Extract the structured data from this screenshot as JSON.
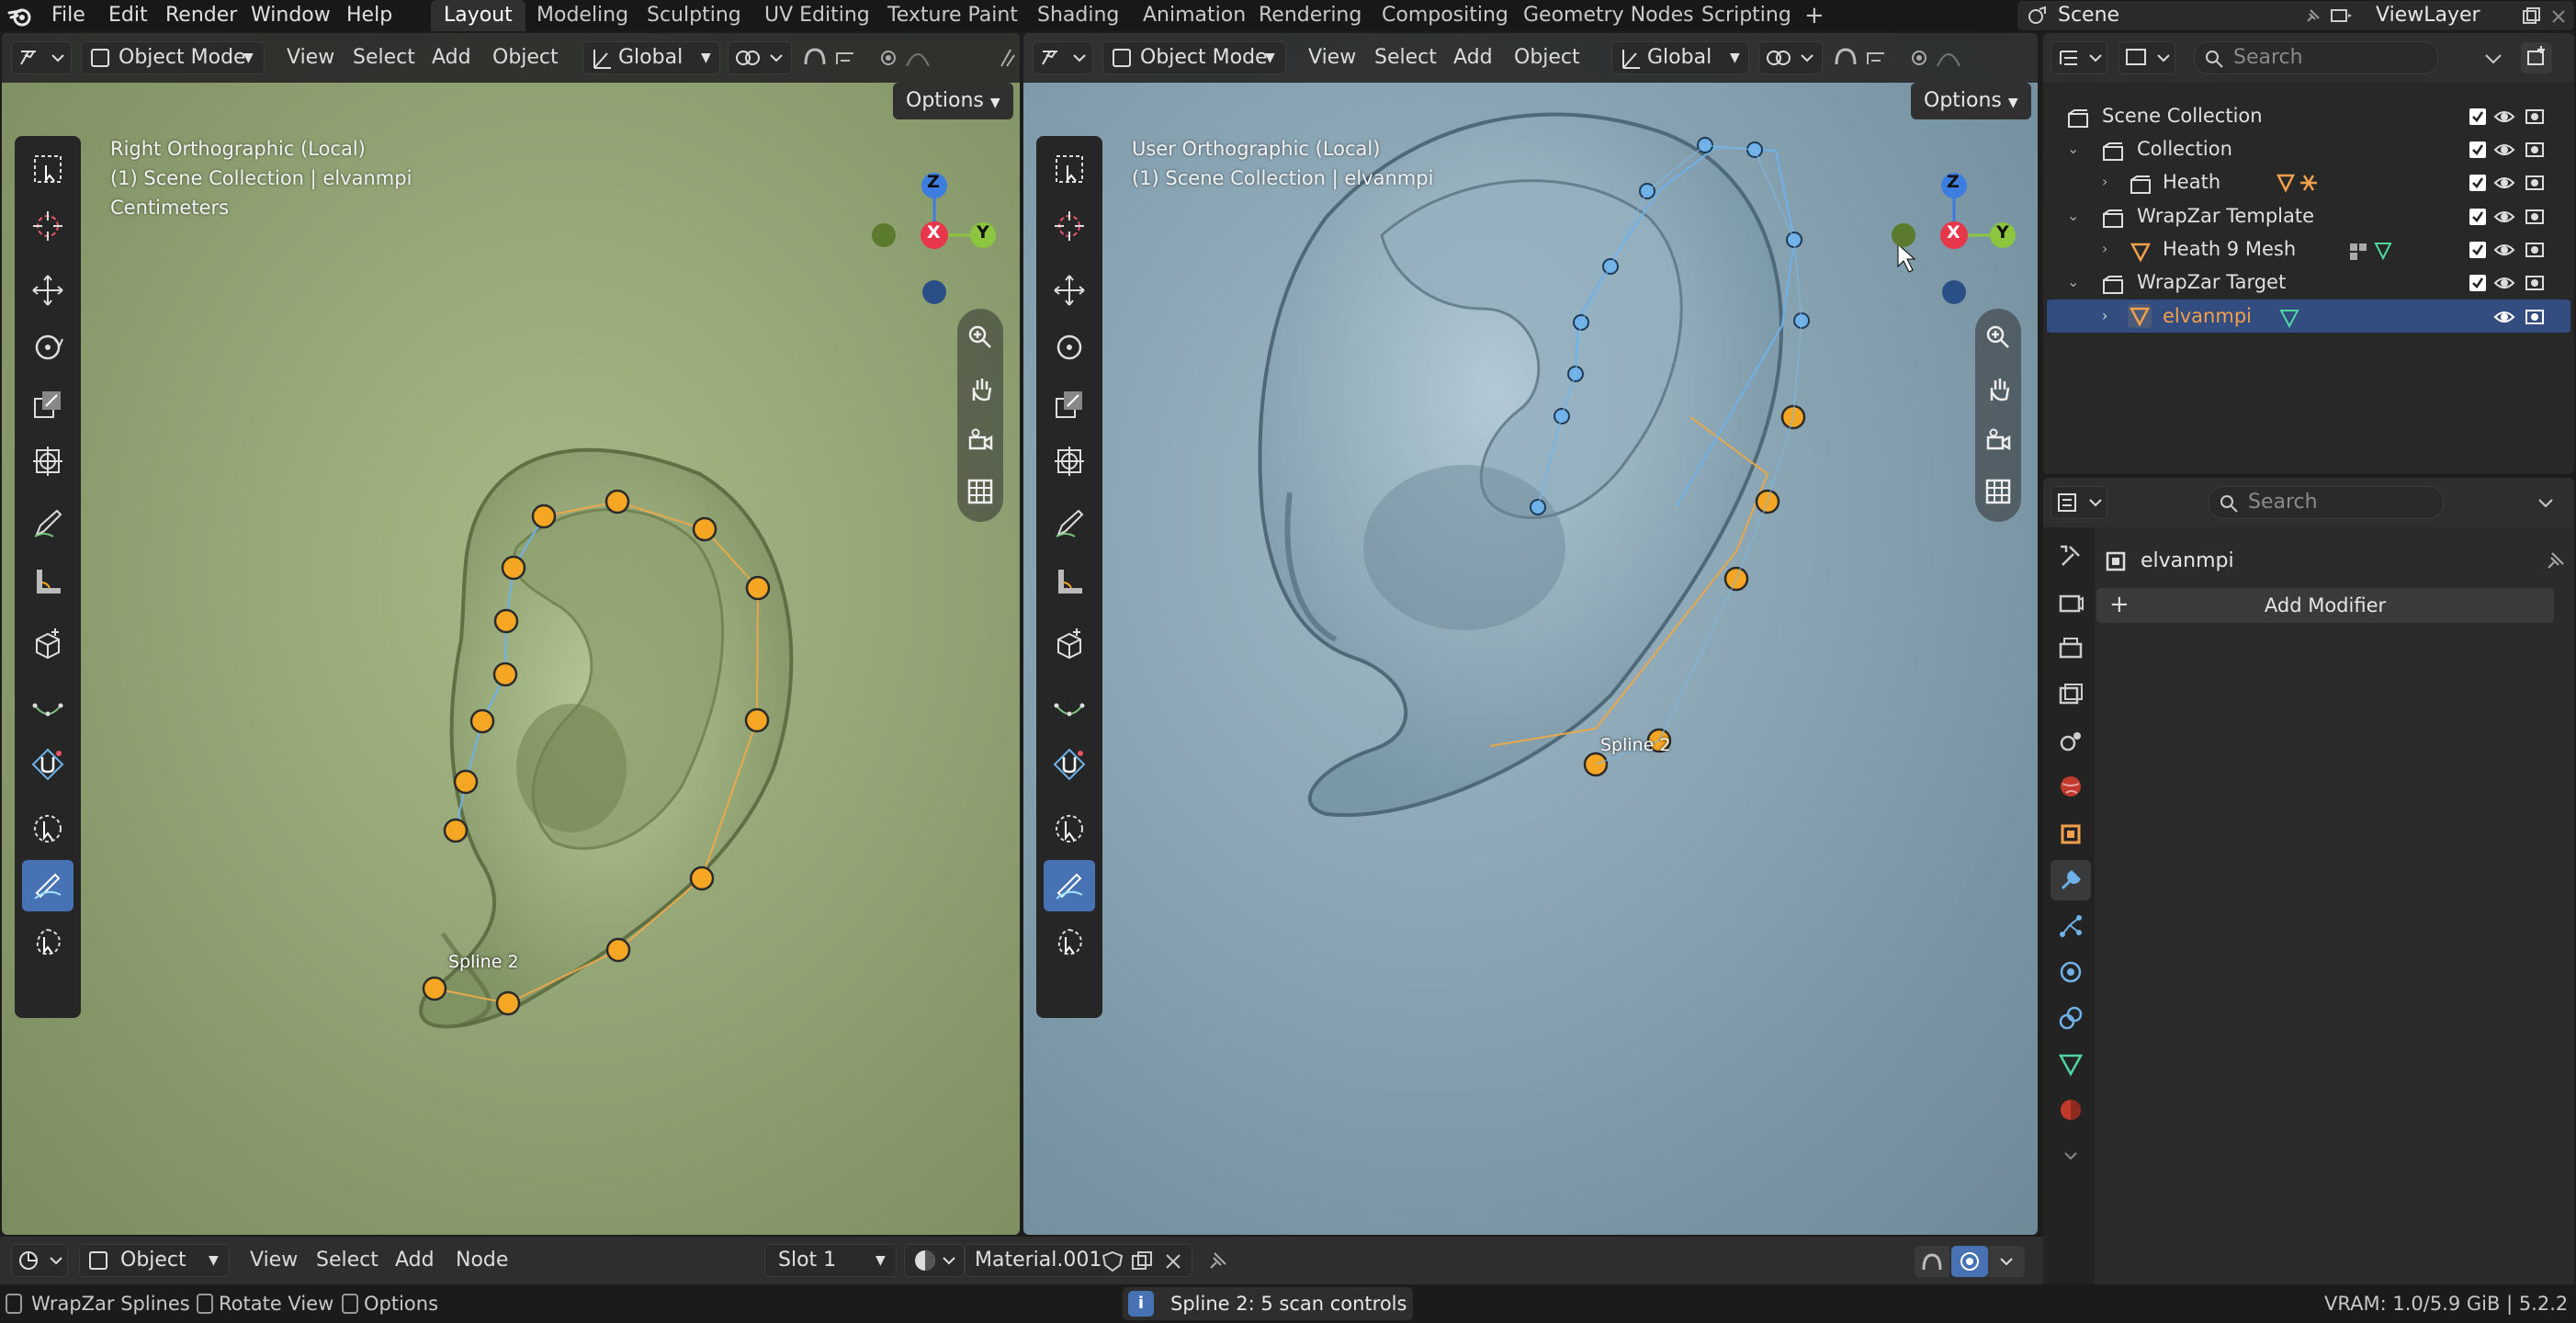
{
  "menubar": {
    "items": [
      "File",
      "Edit",
      "Render",
      "Window",
      "Help"
    ],
    "workspaces": [
      "Layout",
      "Modeling",
      "Sculpting",
      "UV Editing",
      "Texture Paint",
      "Shading",
      "Animation",
      "Rendering",
      "Compositing",
      "Geometry Nodes",
      "Scripting"
    ],
    "add_tab": "+",
    "scene": "Scene",
    "view_layer": "ViewLayer"
  },
  "viewport_left": {
    "mode": "Object Mode",
    "menus": [
      "View",
      "Select",
      "Add",
      "Object"
    ],
    "orientation": "Global",
    "options": "Options",
    "info_lines": [
      "Right Orthographic (Local)",
      "(1) Scene Collection | elvanmpi",
      "Centimeters"
    ],
    "spline_label": "Spline 2",
    "gizmo": {
      "top": "Z",
      "center": "X",
      "right": "Y"
    }
  },
  "viewport_right": {
    "mode": "Object Mode",
    "menus": [
      "View",
      "Select",
      "Add",
      "Object"
    ],
    "orientation": "Global",
    "options": "Options",
    "info_lines": [
      "User Orthographic (Local)",
      "(1) Scene Collection | elvanmpi"
    ],
    "spline_label": "Spline 2",
    "gizmo": {
      "top": "Z",
      "center": "X",
      "right": "Y"
    }
  },
  "outliner": {
    "search_placeholder": "Search",
    "rows": [
      {
        "label": "Scene Collection"
      },
      {
        "label": "Collection"
      },
      {
        "label": "Heath"
      },
      {
        "label": "WrapZar Template"
      },
      {
        "label": "Heath 9 Mesh"
      },
      {
        "label": "WrapZar Target"
      },
      {
        "label": "elvanmpi",
        "selected": true
      }
    ]
  },
  "properties": {
    "search_placeholder": "Search",
    "object_name": "elvanmpi",
    "add_modifier": "Add Modifier",
    "add_icon": "+"
  },
  "node_header": {
    "mode": "Object",
    "menus": [
      "View",
      "Select",
      "Add",
      "Node"
    ],
    "slot": "Slot 1",
    "material": "Material.001"
  },
  "statusbar": {
    "left": [
      "WrapZar Splines",
      "Rotate View",
      "Options"
    ],
    "center": "Spline 2: 5 scan controls",
    "right": "VRAM: 1.0/5.9 GiB | 5.2.2"
  },
  "colors": {
    "accent": "#4772b3",
    "point_orange": "#f5a623",
    "point_blue": "#6fb2ea",
    "x_red": "#e8364a",
    "y_green": "#8cc63f",
    "z_blue": "#3d7de0",
    "selected_name": "#f2a04b"
  },
  "icons": [
    "blender-logo",
    "search-icon",
    "eye-icon",
    "camera-icon",
    "checkbox-icon",
    "chevron-right-icon",
    "collection-icon",
    "mesh-icon",
    "wrench-icon",
    "cursor-icon",
    "move-icon",
    "rotate-icon",
    "scale-icon",
    "transform-icon",
    "annotate-icon",
    "measure-icon",
    "add-cube-icon",
    "zoom-icon",
    "hand-icon",
    "camera-view-icon",
    "grid-icon",
    "pin-icon",
    "info-icon"
  ]
}
